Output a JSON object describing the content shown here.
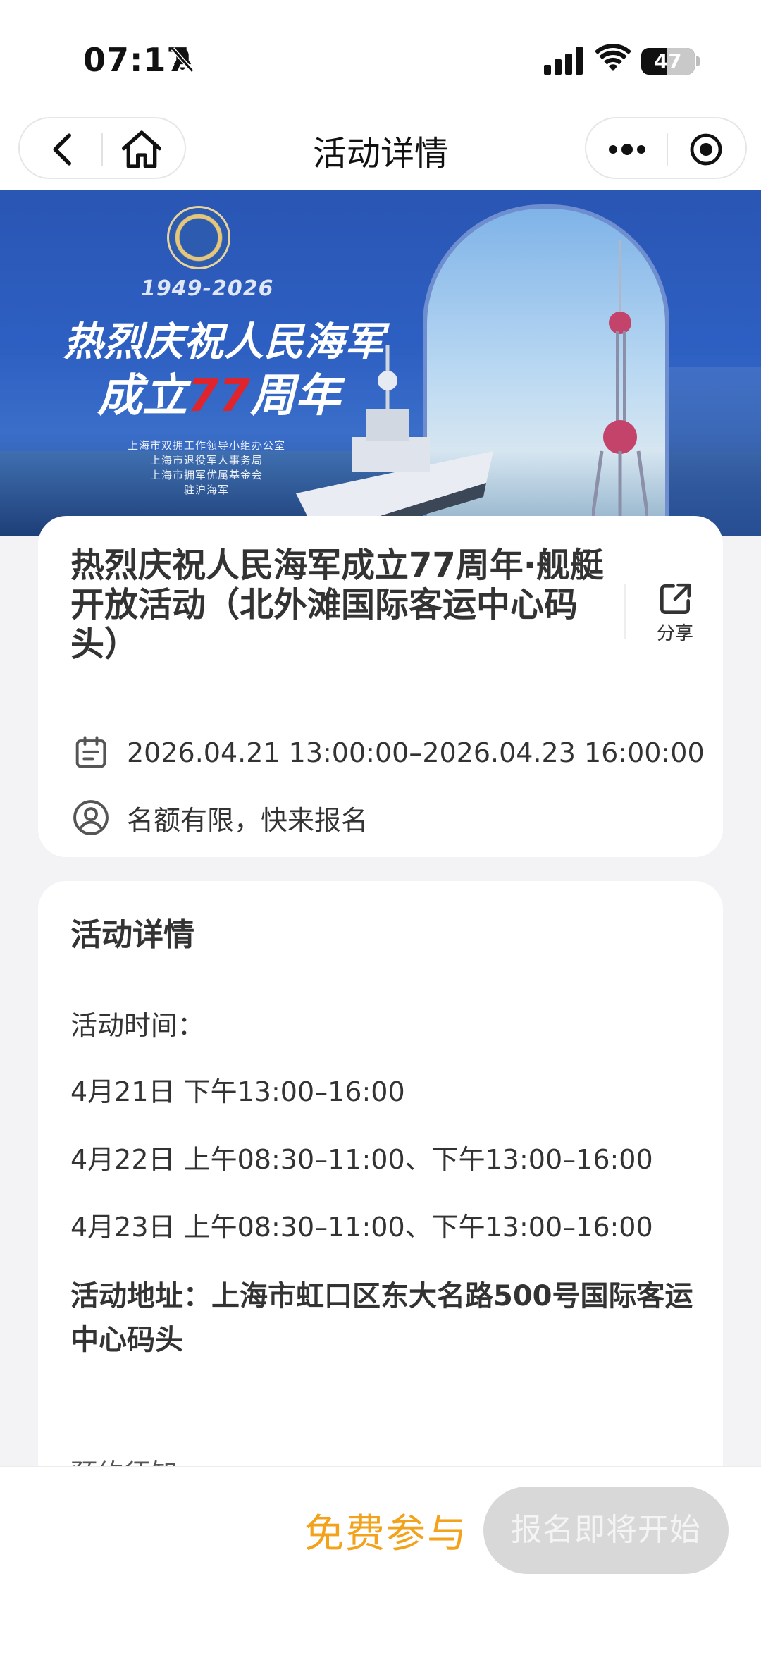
{
  "status_bar": {
    "time": "07:17",
    "battery": "47",
    "battery_level": 0.47,
    "icons": [
      "bell-slash-icon",
      "signal-icon",
      "wifi-icon",
      "battery-icon"
    ]
  },
  "nav": {
    "title": "活动详情",
    "icons": [
      "back-icon",
      "home-icon",
      "more-icon",
      "close-mini-program-icon"
    ]
  },
  "banner": {
    "years": "1949-2026",
    "title_line1": "热烈庆祝人民海军",
    "title_line2_prefix": "成立",
    "title_line2_number": "77",
    "title_line2_suffix": "周年",
    "organizers": [
      "上海市双拥工作领导小组办公室",
      "上海市退役军人事务局",
      "上海市拥军优属基金会",
      "驻沪海军"
    ]
  },
  "event": {
    "title": "热烈庆祝人民海军成立77周年·舰艇开放活动（北外滩国际客运中心码头）",
    "share_label": "分享",
    "date_range": "2026.04.21 13:00:00–2026.04.23 16:00:00",
    "quota_text": "名额有限，快来报名"
  },
  "details": {
    "heading": "活动详情",
    "time_label": "活动时间：",
    "schedule": [
      "4月21日 下午13:00–16:00",
      "4月22日 上午08:30–11:00、下午13:00–16:00",
      "4月23日 上午08:30–11:00、下午13:00–16:00"
    ],
    "address": "活动地址：上海市虹口区东大名路500号国际客运中心码头",
    "next_section_partial": "预约须知"
  },
  "footer": {
    "price_label": "免费参与",
    "signup_label": "报名即将开始"
  },
  "colors": {
    "accent_orange": "#f2a21b",
    "disabled_button": "#d8d8d8",
    "banner_blue": "#2d5fc2",
    "banner_red": "#e0242c"
  }
}
